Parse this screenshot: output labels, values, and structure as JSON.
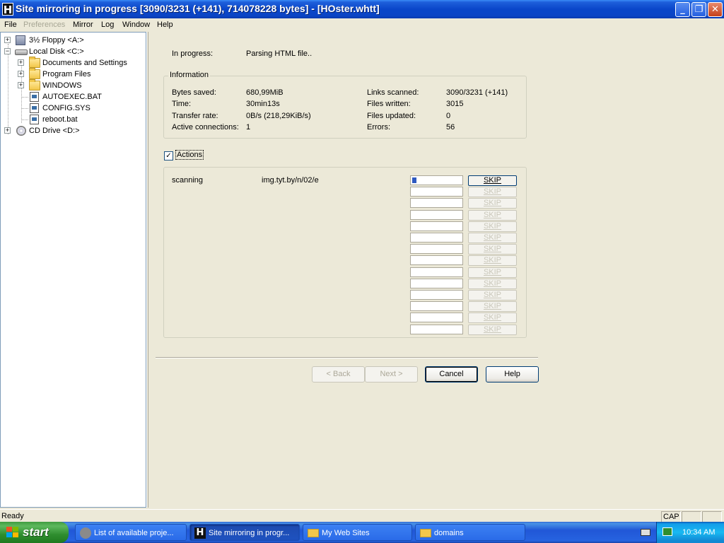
{
  "window": {
    "title": "Site mirroring in progress [3090/3231 (+141), 714078228 bytes] - [HOster.whtt]",
    "icon": "httrack-icon",
    "controls": [
      "minimize",
      "restore",
      "close"
    ]
  },
  "menu": {
    "file": "File",
    "preferences": "Preferences",
    "mirror": "Mirror",
    "log": "Log",
    "window": "Window",
    "help": "Help"
  },
  "tree": {
    "floppy": "3½ Floppy <A:>",
    "local_disk": "Local Disk <C:>",
    "documents": "Documents and Settings",
    "program_files": "Program Files",
    "windows": "WINDOWS",
    "autoexec": "AUTOEXEC.BAT",
    "config": "CONFIG.SYS",
    "reboot": "reboot.bat",
    "cd_drive": "CD Drive <D:>"
  },
  "progress": {
    "in_progress_label": "In progress:",
    "in_progress_value": "Parsing HTML file.."
  },
  "info": {
    "legend": "Information",
    "bytes_saved_label": "Bytes saved:",
    "bytes_saved_value": "680,99MiB",
    "time_label": "Time:",
    "time_value": "30min13s",
    "transfer_label": "Transfer rate:",
    "transfer_value": "0B/s (218,29KiB/s)",
    "connections_label": "Active connections:",
    "connections_value": "1",
    "links_label": "Links scanned:",
    "links_value": "3090/3231 (+141)",
    "files_written_label": "Files written:",
    "files_written_value": "3015",
    "files_updated_label": "Files updated:",
    "files_updated_value": "0",
    "errors_label": "Errors:",
    "errors_value": "56"
  },
  "actions": {
    "checkbox_label": "Actions",
    "checked": true,
    "rows": [
      {
        "status": "scanning",
        "url": "img.tyt.by/n/02/e",
        "progress": 0.08,
        "skip": "SKIP",
        "enabled": true
      },
      {
        "status": "",
        "url": "",
        "progress": 0,
        "skip": "SKIP",
        "enabled": false
      },
      {
        "status": "",
        "url": "",
        "progress": 0,
        "skip": "SKIP",
        "enabled": false
      },
      {
        "status": "",
        "url": "",
        "progress": 0,
        "skip": "SKIP",
        "enabled": false
      },
      {
        "status": "",
        "url": "",
        "progress": 0,
        "skip": "SKIP",
        "enabled": false
      },
      {
        "status": "",
        "url": "",
        "progress": 0,
        "skip": "SKIP",
        "enabled": false
      },
      {
        "status": "",
        "url": "",
        "progress": 0,
        "skip": "SKIP",
        "enabled": false
      },
      {
        "status": "",
        "url": "",
        "progress": 0,
        "skip": "SKIP",
        "enabled": false
      },
      {
        "status": "",
        "url": "",
        "progress": 0,
        "skip": "SKIP",
        "enabled": false
      },
      {
        "status": "",
        "url": "",
        "progress": 0,
        "skip": "SKIP",
        "enabled": false
      },
      {
        "status": "",
        "url": "",
        "progress": 0,
        "skip": "SKIP",
        "enabled": false
      },
      {
        "status": "",
        "url": "",
        "progress": 0,
        "skip": "SKIP",
        "enabled": false
      },
      {
        "status": "",
        "url": "",
        "progress": 0,
        "skip": "SKIP",
        "enabled": false
      },
      {
        "status": "",
        "url": "",
        "progress": 0,
        "skip": "SKIP",
        "enabled": false
      }
    ]
  },
  "buttons": {
    "back": "< Back",
    "next": "Next >",
    "cancel": "Cancel",
    "help": "Help"
  },
  "statusbar": {
    "text": "Ready",
    "caps": "CAP"
  },
  "taskbar": {
    "start": "start",
    "tasks": [
      {
        "label": "List of available proje...",
        "icon": "raccoon-icon",
        "active": false
      },
      {
        "label": "Site mirroring in progr...",
        "icon": "httrack-icon",
        "active": true
      },
      {
        "label": "My Web Sites",
        "icon": "folder-icon",
        "active": false
      },
      {
        "label": "domains",
        "icon": "folder-icon",
        "active": false
      }
    ],
    "clock": "10:34 AM"
  },
  "colors": {
    "titlebar": "#0A46C9",
    "face": "#ECE9D8",
    "progress_fill": "#2F5AC1",
    "start_green": "#3F9C3F"
  }
}
